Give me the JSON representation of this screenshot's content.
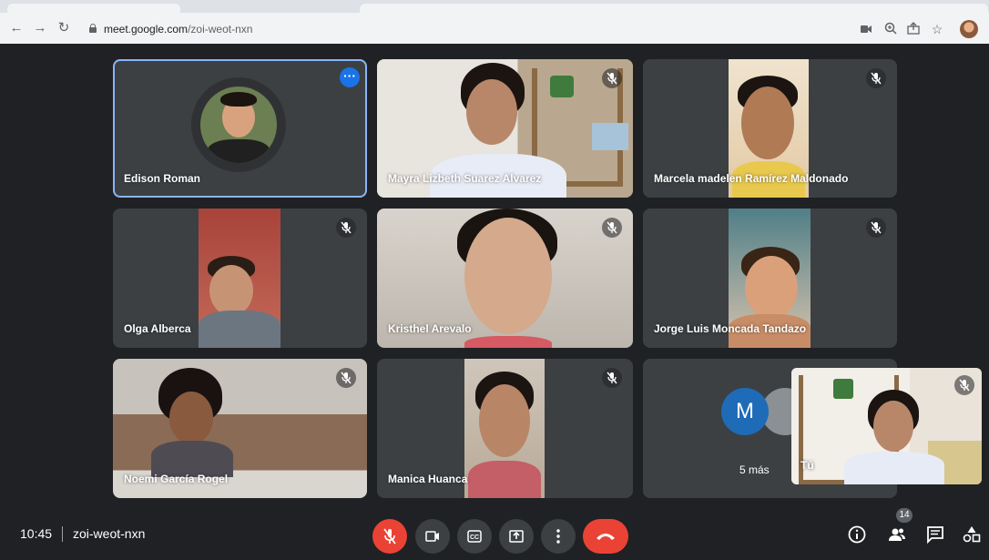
{
  "browser": {
    "url_host": "meet.google.com",
    "url_path": "/zoi-weot-nxn"
  },
  "participants": [
    {
      "name": "Edison Roman"
    },
    {
      "name": "Mayra Lizbeth Suarez Alvarez"
    },
    {
      "name": "Marcela madelen Ramírez Maldonado"
    },
    {
      "name": "Olga Alberca"
    },
    {
      "name": "Kristhel Arevalo"
    },
    {
      "name": "Jorge Luis Moncada Tandazo"
    },
    {
      "name": "Noemi García Rogel"
    },
    {
      "name": "Manica Huanca"
    }
  ],
  "more_tile": {
    "initial": "M",
    "label": "5 más"
  },
  "self_tile": {
    "label": "Tú"
  },
  "meeting": {
    "time": "10:45",
    "code": "zoi-weot-nxn"
  },
  "people_count": "14",
  "colors": {
    "active_border": "#8ab4f8",
    "accent_blue": "#1a73e8",
    "danger_red": "#ea4335",
    "background": "#202124",
    "tile": "#3c4043"
  }
}
